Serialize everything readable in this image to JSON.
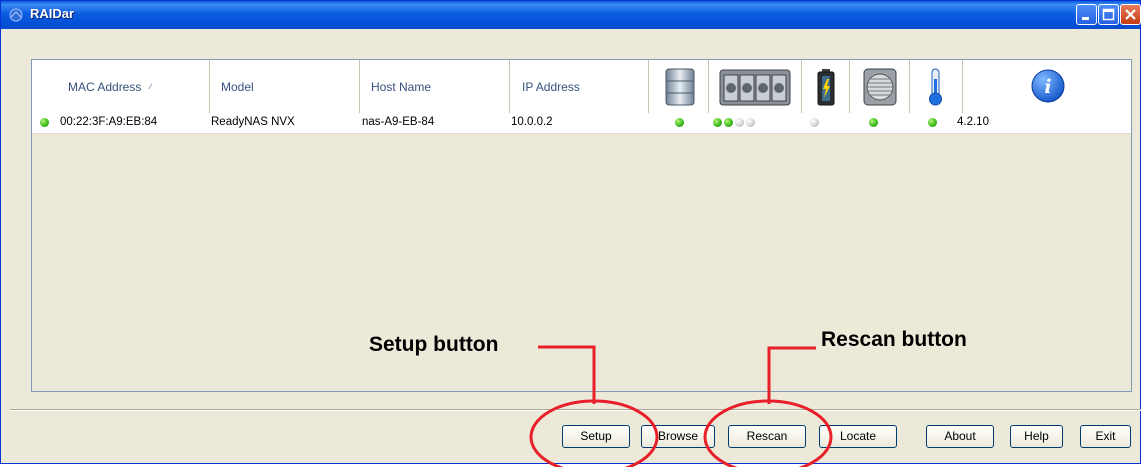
{
  "window": {
    "title": "RAIDar",
    "icon": "raidar-app-icon"
  },
  "columns": {
    "mac": "MAC Address",
    "model": "Model",
    "host": "Host Name",
    "ip": "IP Address",
    "icons": [
      "volume-icon",
      "disks-icon",
      "ups-battery-icon",
      "fan-icon",
      "temperature-icon",
      "info-icon"
    ]
  },
  "devices": [
    {
      "mac": "00:22:3F:A9:EB:84",
      "model": "ReadyNAS NVX",
      "host": "nas-A9-EB-84",
      "ip": "10.0.0.2",
      "status": "on",
      "volume": "on",
      "disks": [
        "on",
        "on",
        "off",
        "off"
      ],
      "ups": "off",
      "fan": "on",
      "temperature": "on",
      "version": "4.2.10"
    }
  ],
  "buttons": {
    "setup": "Setup",
    "browse": "Browse",
    "rescan": "Rescan",
    "locate": "Locate",
    "about": "About",
    "help": "Help",
    "exit": "Exit"
  },
  "annotations": {
    "setup": "Setup button",
    "rescan": "Rescan button",
    "color": "#e8202a"
  }
}
